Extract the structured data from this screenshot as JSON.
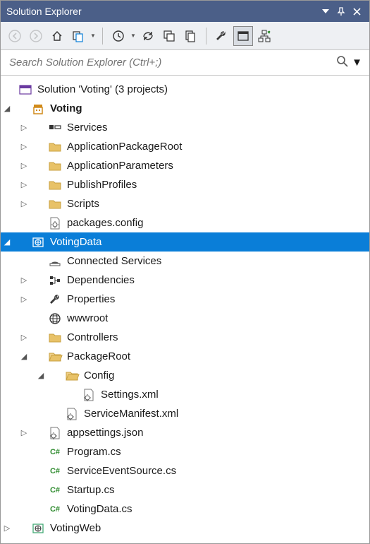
{
  "titlebar": {
    "title": "Solution Explorer"
  },
  "search": {
    "placeholder": "Search Solution Explorer (Ctrl+;)"
  },
  "tree": {
    "solution": "Solution 'Voting' (3 projects)",
    "proj_voting": "Voting",
    "voting": {
      "services": "Services",
      "app_pkg_root": "ApplicationPackageRoot",
      "app_params": "ApplicationParameters",
      "publish_profiles": "PublishProfiles",
      "scripts": "Scripts",
      "packages_config": "packages.config"
    },
    "proj_votingdata": "VotingData",
    "votingdata": {
      "connected_services": "Connected Services",
      "dependencies": "Dependencies",
      "properties": "Properties",
      "wwwroot": "wwwroot",
      "controllers": "Controllers",
      "package_root": "PackageRoot",
      "config": "Config",
      "settings_xml": "Settings.xml",
      "service_manifest": "ServiceManifest.xml",
      "appsettings": "appsettings.json",
      "program_cs": "Program.cs",
      "service_event_source_cs": "ServiceEventSource.cs",
      "startup_cs": "Startup.cs",
      "votingdata_cs": "VotingData.cs"
    },
    "proj_votingweb": "VotingWeb"
  }
}
